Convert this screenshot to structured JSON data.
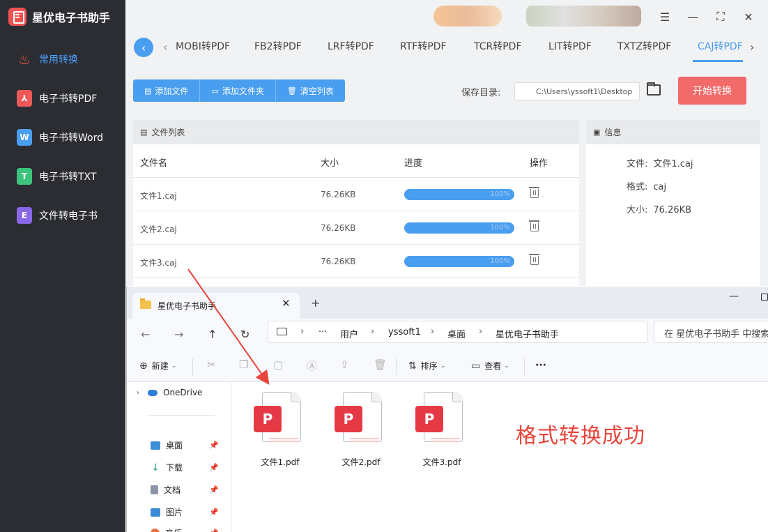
{
  "app": {
    "title": "星优电子书助手"
  },
  "sidebar": {
    "items": [
      {
        "label": "常用转换",
        "icon": "fire-icon",
        "active": true
      },
      {
        "label": "电子书转PDF",
        "icon": "pdf-icon",
        "glyph": "⅄"
      },
      {
        "label": "电子书转Word",
        "icon": "word-icon",
        "glyph": "W"
      },
      {
        "label": "电子书转TXT",
        "icon": "txt-icon",
        "glyph": "T"
      },
      {
        "label": "文件转电子书",
        "icon": "ebook-icon",
        "glyph": "E"
      }
    ]
  },
  "tabs": [
    {
      "label": "MOBI转PDF"
    },
    {
      "label": "FB2转PDF"
    },
    {
      "label": "LRF转PDF"
    },
    {
      "label": "RTF转PDF"
    },
    {
      "label": "TCR转PDF"
    },
    {
      "label": "LIT转PDF"
    },
    {
      "label": "TXTZ转PDF"
    },
    {
      "label": "CAJ转PDF",
      "active": true
    }
  ],
  "toolbar": {
    "add_file": "添加文件",
    "add_folder": "添加文件夹",
    "clear_list": "清空列表",
    "save_dir_label": "保存目录:",
    "save_dir_value": "C:\\Users\\yssoft1\\Desktop",
    "start": "开始转换"
  },
  "file_list": {
    "panel_title": "文件列表",
    "columns": {
      "name": "文件名",
      "size": "大小",
      "progress": "进度",
      "actions": "操作"
    },
    "rows": [
      {
        "name": "文件1.caj",
        "size": "76.26KB",
        "progress_percent": 100,
        "progress_label": "100%"
      },
      {
        "name": "文件2.caj",
        "size": "76.26KB",
        "progress_percent": 100,
        "progress_label": "100%"
      },
      {
        "name": "文件3.caj",
        "size": "76.26KB",
        "progress_percent": 100,
        "progress_label": "100%"
      }
    ]
  },
  "info": {
    "panel_title": "信息",
    "file_label": "文件:",
    "file_value": "文件1.caj",
    "format_label": "格式:",
    "format_value": "caj",
    "size_label": "大小:",
    "size_value": "76.26KB"
  },
  "explorer": {
    "tab_title": "星优电子书助手",
    "breadcrumb": [
      "用户",
      "yssoft1",
      "桌面",
      "星优电子书助手"
    ],
    "search_placeholder": "在 星优电子书助手 中搜索",
    "toolbar": {
      "new": "新建",
      "sort": "排序",
      "view": "查看",
      "more": "···"
    },
    "nav": [
      {
        "label": "OneDrive",
        "icon": "onedrive-icon"
      },
      {
        "label": "桌面",
        "icon": "desktop-icon",
        "pinned": true
      },
      {
        "label": "下载",
        "icon": "download-icon",
        "pinned": true
      },
      {
        "label": "文档",
        "icon": "documents-icon",
        "pinned": true
      },
      {
        "label": "图片",
        "icon": "pictures-icon",
        "pinned": true
      },
      {
        "label": "音乐",
        "icon": "music-icon",
        "pinned": true
      }
    ],
    "files": [
      {
        "name": "文件1.pdf"
      },
      {
        "name": "文件2.pdf"
      },
      {
        "name": "文件3.pdf"
      }
    ],
    "annotation": "格式转换成功"
  },
  "colors": {
    "accent": "#4a9eef",
    "start_button": "#f26a6a",
    "sidebar_bg": "#2b2d33",
    "annotation": "#e8453c"
  }
}
